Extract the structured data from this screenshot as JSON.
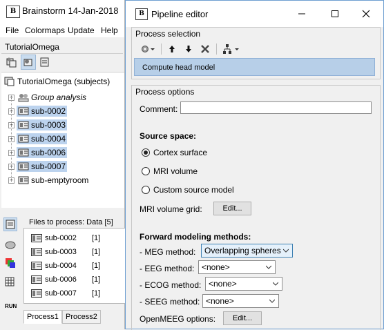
{
  "main_window": {
    "title": "Brainstorm 14-Jan-2018",
    "menu": [
      "File",
      "Colormaps",
      "Update",
      "Help"
    ],
    "protocol_name": "TutorialOmega",
    "tree": {
      "root_label": "TutorialOmega (subjects)",
      "items": [
        {
          "label": "Group analysis",
          "selected": false,
          "italic": true
        },
        {
          "label": "sub-0002",
          "selected": true,
          "italic": false
        },
        {
          "label": "sub-0003",
          "selected": true,
          "italic": false
        },
        {
          "label": "sub-0004",
          "selected": true,
          "italic": false
        },
        {
          "label": "sub-0006",
          "selected": true,
          "italic": false
        },
        {
          "label": "sub-0007",
          "selected": true,
          "italic": false
        },
        {
          "label": "sub-emptyroom",
          "selected": false,
          "italic": false
        }
      ]
    },
    "files_header": "Files to process: Data [5]",
    "files": [
      {
        "name": "sub-0002",
        "count": "[1]"
      },
      {
        "name": "sub-0003",
        "count": "[1]"
      },
      {
        "name": "sub-0004",
        "count": "[1]"
      },
      {
        "name": "sub-0006",
        "count": "[1]"
      },
      {
        "name": "sub-0007",
        "count": "[1]"
      }
    ],
    "run_label": "RUN",
    "process_tabs": [
      "Process1",
      "Process2"
    ]
  },
  "pipeline_editor": {
    "title": "Pipeline editor",
    "process_selection_title": "Process selection",
    "selected_process": "Compute head model",
    "process_options_title": "Process options",
    "comment_label": "Comment:",
    "comment_value": "",
    "source_space_label": "Source space:",
    "source_space_options": [
      "Cortex surface",
      "MRI volume",
      "Custom source model"
    ],
    "source_space_selected": "Cortex surface",
    "mri_grid_label": "MRI volume grid:",
    "edit_label": "Edit...",
    "forward_methods_label": "Forward modeling methods:",
    "meg_label": "- MEG method:",
    "meg_value": "Overlapping spheres",
    "eeg_label": "- EEG method:",
    "eeg_value": "<none>",
    "ecog_label": "- ECOG method:",
    "ecog_value": "<none>",
    "seeg_label": "- SEEG method:",
    "seeg_value": "<none>",
    "openmeeg_label": "OpenMEEG options:",
    "openmeeg_edit_label": "Edit..."
  },
  "colors": {
    "selection": "#bcd3ee",
    "process_list": "#b7cfe8",
    "window_border": "#6d9ed1"
  }
}
